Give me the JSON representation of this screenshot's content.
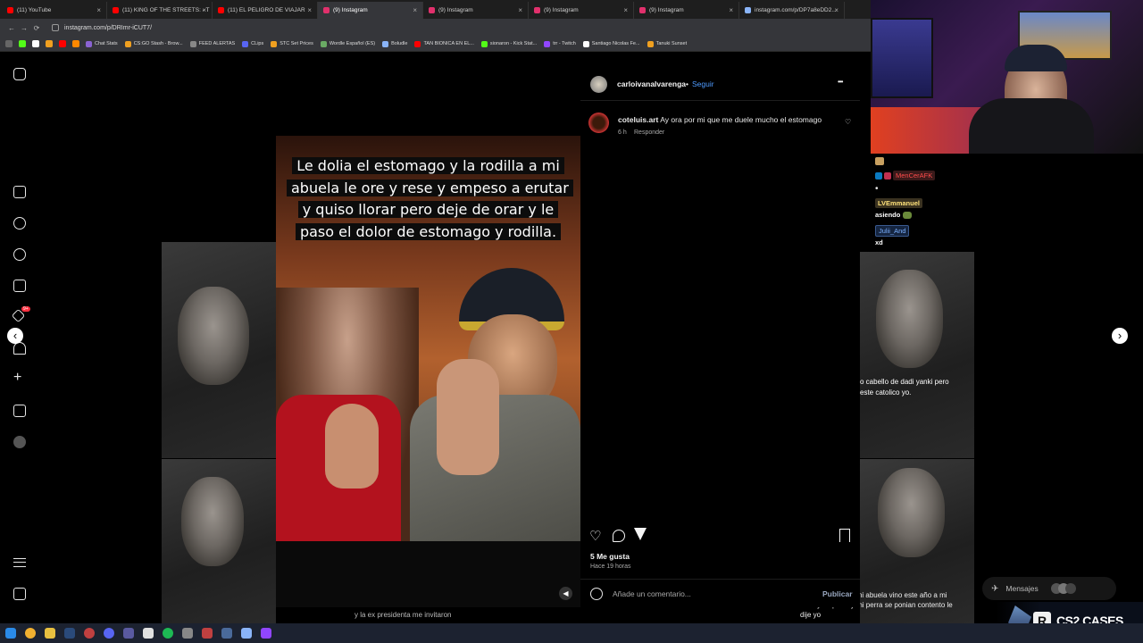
{
  "browser": {
    "tabs": [
      {
        "label": "(11) YouTube",
        "color": "#ff0000",
        "active": false
      },
      {
        "label": "(11) KING OF THE STREETS: - T",
        "color": "#ff0000",
        "active": false
      },
      {
        "label": "(11) EL PELIGRO DE VIAJAR",
        "color": "#ff0000",
        "active": false
      },
      {
        "label": "(9) Instagram",
        "color": "#e1306c",
        "active": true
      },
      {
        "label": "(9) Instagram",
        "color": "#e1306c",
        "active": false
      },
      {
        "label": "(9) Instagram",
        "color": "#e1306c",
        "active": false
      },
      {
        "label": "(9) Instagram",
        "color": "#e1306c",
        "active": false
      },
      {
        "label": "instagram.com/p/DP7a8eDD2...",
        "color": "#8ab4f8",
        "active": false
      }
    ],
    "close_glyph": "×",
    "url": "instagram.com/p/DRImr-iCUT7/",
    "bookmarks": [
      {
        "label": "Chat Stats",
        "color": "#8a63d2"
      },
      {
        "label": "CS:GO Stash - Brow...",
        "color": "#f0a020"
      },
      {
        "label": "FEED ALERTAS",
        "color": "#888888"
      },
      {
        "label": "CLips",
        "color": "#5865f2"
      },
      {
        "label": "STC Set Prices",
        "color": "#f0a020"
      },
      {
        "label": "Wordle Español (ES)",
        "color": "#6aaa64"
      },
      {
        "label": "Boludle",
        "color": "#8ab4f8"
      },
      {
        "label": "TAN BIONICA EN EL...",
        "color": "#ff0000"
      },
      {
        "label": "sionaron - Kick Stat...",
        "color": "#53fc18"
      },
      {
        "label": "trr - Twitch",
        "color": "#9146ff"
      },
      {
        "label": "Santiago Nicolas Fe...",
        "color": "#ffffff"
      },
      {
        "label": "Tanuki Sunset",
        "color": "#f0a020"
      }
    ]
  },
  "instagram": {
    "post_image_caption": "Le dolia el estomago y la rodilla a mi abuela le ore y rese y empeso a erutar y quiso llorar pero deje de orar y le paso el dolor de estomago y rodilla.",
    "author": "carloivanalvarenga",
    "separator": "•",
    "follow_label": "Seguir",
    "more_glyph": "•••",
    "comment": {
      "user": "coteluis.art",
      "text": "Ay ora por mi que me duele mucho el estomago",
      "time": "6 h",
      "reply_label": "Responder"
    },
    "likes": "5 Me gusta",
    "posted_ago": "Hace 19 horas",
    "comment_placeholder": "Añade un comentario...",
    "publish_label": "Publicar",
    "bottom_caption": "y la ex presidenta me invitaron",
    "right_bg_caption": "o cabello de dadi yanki pero este catolico yo.",
    "bottom_right_caption": "ar el hermano de mi abuela vino este año a mi casa y mi perro y mi perra se ponian contento le dije yo",
    "messages_label": "Mensajes",
    "notif_badge": "9+",
    "nav_prev": "‹",
    "nav_next": "›"
  },
  "stream_chat": {
    "rows": [
      {
        "user": "MenCerAFK",
        "color": "#ff4b4b",
        "text": ""
      },
      {
        "user": "LVEmmanuel",
        "color": "#ffe27a",
        "text": "asiendo"
      },
      {
        "user": "Julii_And",
        "color": "#7ab0ff",
        "text": "xd"
      }
    ]
  },
  "overlay": {
    "cs2_label": "CS2 CASES",
    "cs2_logo_letter": "R"
  }
}
